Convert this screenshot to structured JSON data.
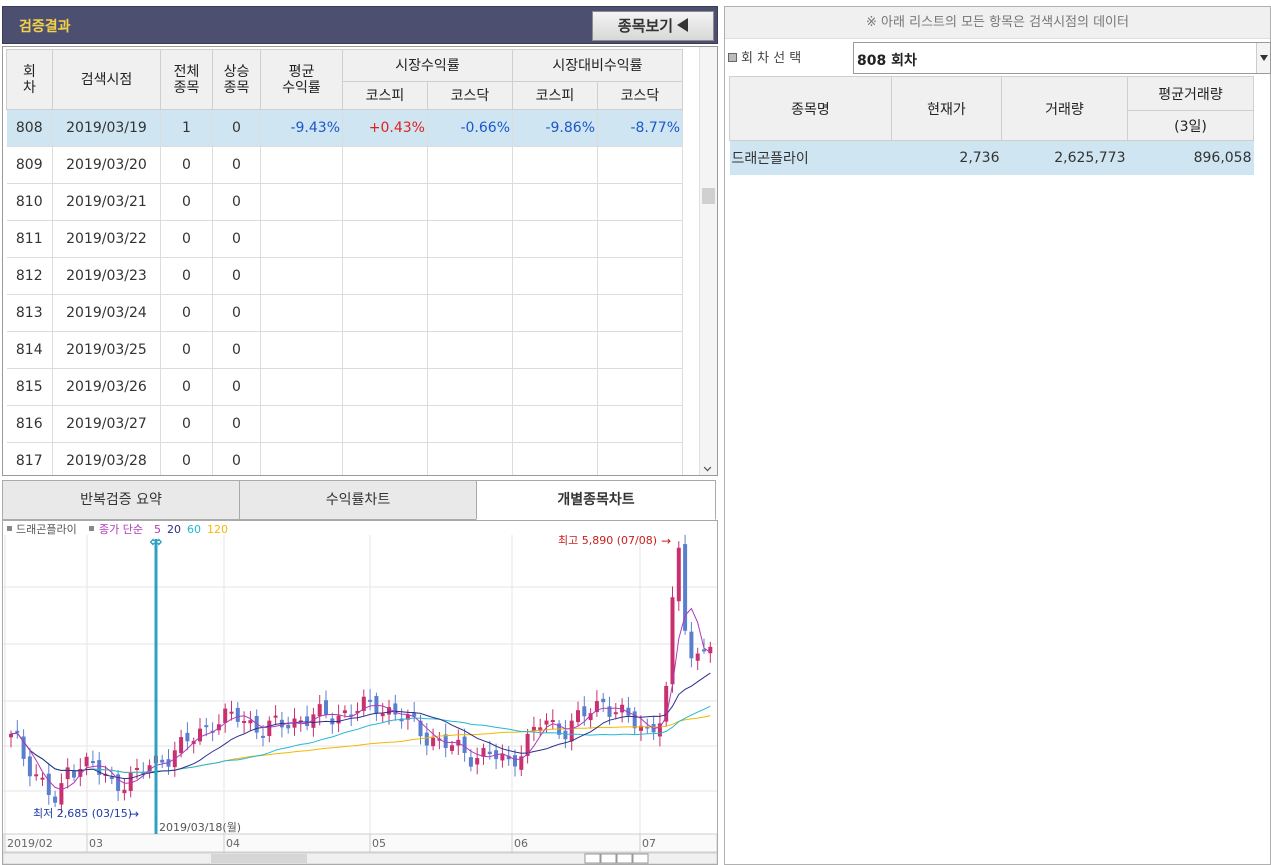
{
  "result": {
    "title": "검증결과",
    "view_button": "종목보기"
  },
  "grid": {
    "headers": {
      "round": "회\n차",
      "search_time": "검색시점",
      "total": "전체\n종목",
      "rising": "상승\n종목",
      "avg_return": "평균\n수익률",
      "market_return": "시장수익률",
      "excess_return": "시장대비수익률",
      "kospi": "코스피",
      "kosdaq": "코스닥"
    },
    "rows": [
      {
        "round": "808",
        "date": "2019/03/19",
        "total": "1",
        "rising": "0",
        "avg": "-9.43%",
        "m_kospi": "+0.43%",
        "m_kosdaq": "-0.66%",
        "e_kospi": "-9.86%",
        "e_kosdaq": "-8.77%"
      },
      {
        "round": "809",
        "date": "2019/03/20",
        "total": "0",
        "rising": "0",
        "avg": "",
        "m_kospi": "",
        "m_kosdaq": "",
        "e_kospi": "",
        "e_kosdaq": ""
      },
      {
        "round": "810",
        "date": "2019/03/21",
        "total": "0",
        "rising": "0",
        "avg": "",
        "m_kospi": "",
        "m_kosdaq": "",
        "e_kospi": "",
        "e_kosdaq": ""
      },
      {
        "round": "811",
        "date": "2019/03/22",
        "total": "0",
        "rising": "0",
        "avg": "",
        "m_kospi": "",
        "m_kosdaq": "",
        "e_kospi": "",
        "e_kosdaq": ""
      },
      {
        "round": "812",
        "date": "2019/03/23",
        "total": "0",
        "rising": "0",
        "avg": "",
        "m_kospi": "",
        "m_kosdaq": "",
        "e_kospi": "",
        "e_kosdaq": ""
      },
      {
        "round": "813",
        "date": "2019/03/24",
        "total": "0",
        "rising": "0",
        "avg": "",
        "m_kospi": "",
        "m_kosdaq": "",
        "e_kospi": "",
        "e_kosdaq": ""
      },
      {
        "round": "814",
        "date": "2019/03/25",
        "total": "0",
        "rising": "0",
        "avg": "",
        "m_kospi": "",
        "m_kosdaq": "",
        "e_kospi": "",
        "e_kosdaq": ""
      },
      {
        "round": "815",
        "date": "2019/03/26",
        "total": "0",
        "rising": "0",
        "avg": "",
        "m_kospi": "",
        "m_kosdaq": "",
        "e_kospi": "",
        "e_kosdaq": ""
      },
      {
        "round": "816",
        "date": "2019/03/27",
        "total": "0",
        "rising": "0",
        "avg": "",
        "m_kospi": "",
        "m_kosdaq": "",
        "e_kospi": "",
        "e_kosdaq": ""
      },
      {
        "round": "817",
        "date": "2019/03/28",
        "total": "0",
        "rising": "0",
        "avg": "",
        "m_kospi": "",
        "m_kosdaq": "",
        "e_kospi": "",
        "e_kosdaq": ""
      }
    ]
  },
  "tabs": [
    {
      "label": "반복검증 요약",
      "active": false
    },
    {
      "label": "수익률차트",
      "active": false
    },
    {
      "label": "개별종목차트",
      "active": true
    }
  ],
  "chart_data": {
    "type": "candlestick",
    "legend": {
      "stock": "드래곤플라이",
      "price_label": "종가 단순",
      "ma_periods": [
        "5",
        "20",
        "60",
        "120"
      ]
    },
    "colors": {
      "up": "#c8306e",
      "down": "#5b7fcf",
      "ma5": "#b03ab8",
      "ma20": "#2b2f8a",
      "ma60": "#22b8d4",
      "ma120": "#f2b800",
      "marker": "#2fa0c0"
    },
    "annotations": {
      "high": "최고 5,890 (07/08)",
      "low": "최저 2,685 (03/15)",
      "marker_date": "2019/03/18(월)"
    },
    "x_axis_labels": [
      "2019/02",
      "03",
      "04",
      "05",
      "06",
      "07"
    ],
    "high_value": 5890,
    "low_value": 2685
  },
  "right": {
    "notice": "※ 아래 리스트의 모든 항목은 검색시점의 데이터",
    "round_label": "회 차 선 택",
    "round_value": "808 회차",
    "headers": {
      "name": "종목명",
      "price": "현재가",
      "volume": "거래량",
      "avg_volume": "평균거래량",
      "avg_days": "(3일)"
    },
    "rows": [
      {
        "name": "드래곤플라이",
        "price": "2,736",
        "volume": "2,625,773",
        "avg_volume": "896,058"
      }
    ]
  }
}
